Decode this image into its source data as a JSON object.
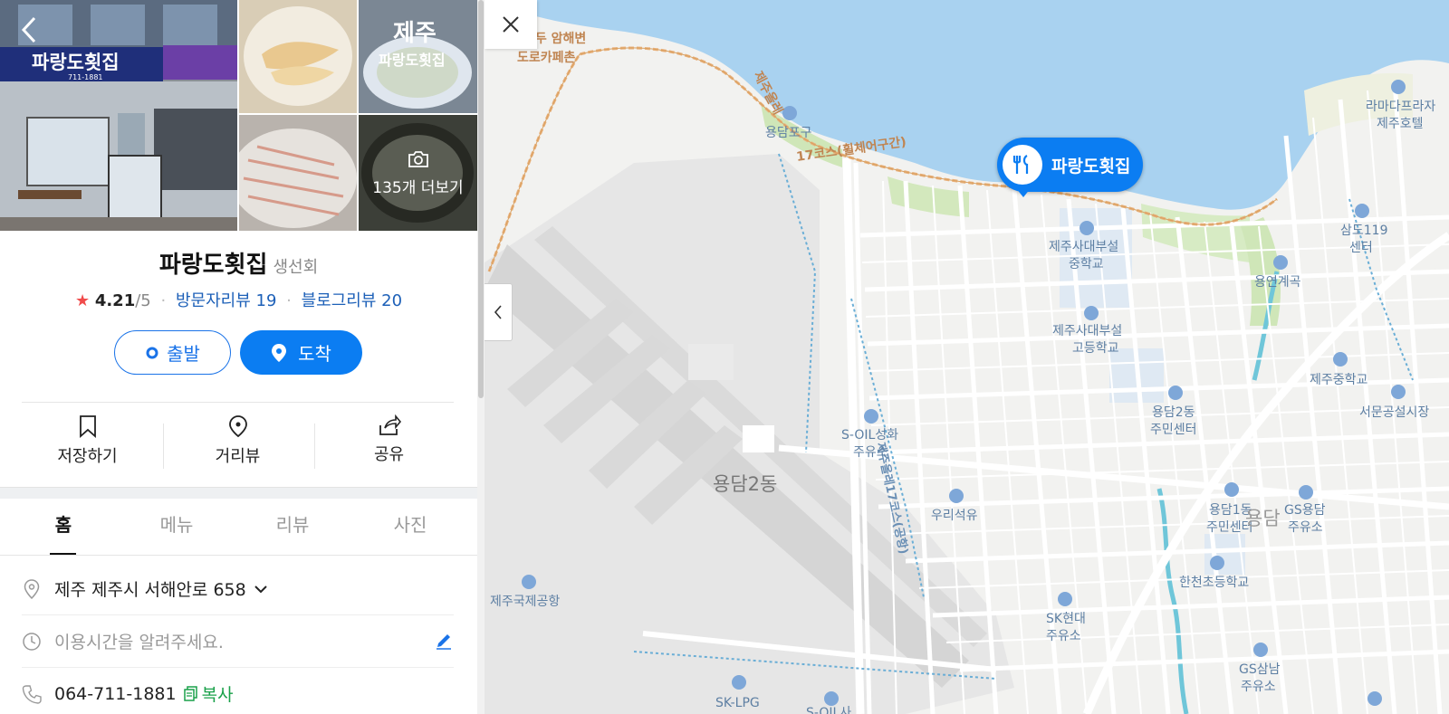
{
  "place": {
    "name": "파랑도횟집",
    "category": "생선회",
    "rating": "4.21",
    "rating_max": "/5",
    "visitor_reviews": "방문자리뷰 19",
    "blog_reviews": "블로그리뷰 20",
    "sign_text": "파랑도횟집",
    "sign_phone": "711-1881",
    "photo_overlay_text": "제주",
    "photo_overlay_sub": "파랑도횟집",
    "photo_more": "135개 더보기"
  },
  "buttons": {
    "start": "출발",
    "arrive": "도착"
  },
  "actions": {
    "save": "저장하기",
    "street_view": "거리뷰",
    "share": "공유"
  },
  "tabs": [
    "홈",
    "메뉴",
    "리뷰",
    "사진"
  ],
  "info": {
    "address": "제주 제주시 서해안로 658",
    "hours_placeholder": "이용시간을 알려주세요.",
    "phone": "064-711-1881",
    "copy": "복사"
  },
  "map": {
    "marker_label": "파랑도횟집",
    "labels": {
      "beach_cafe_1": "도두 암해변",
      "beach_cafe_2": "도로카페촌",
      "yongdam_port": "용담포구",
      "olle_route_17": "17코스(휠체어구간)",
      "olle_route_vertical": "제주올레17코스(공항)",
      "olle_route_top": "제주올레",
      "ramada_1": "라마다프라자",
      "ramada_2": "제주호텔",
      "jeju_middle_1": "제주사대부설",
      "jeju_middle_2": "중학교",
      "jeju_high_1": "제주사대부설",
      "jeju_high_2": "고등학교",
      "samdo_119_1": "삼도119",
      "samdo_119_2": "센터",
      "yongyeon": "용연계곡",
      "jeju_middle_school": "제주중학교",
      "seomun_market": "서문공설시장",
      "yongdam2_center_1": "용담2동",
      "yongdam2_center_2": "주민센터",
      "soil_1": "S-OIL성화",
      "soil_2": "주유소",
      "yongdam2_dong": "용담2동",
      "uri_gas": "우리석유",
      "yongdam1_center_1": "용담1동",
      "yongdam1_center_2": "주민센터",
      "gs_yongdam_1": "GS용담",
      "gs_yongdam_2": "주유소",
      "hancheon_school": "한천초등학교",
      "airport": "제주국제공항",
      "sk_1": "SK현대",
      "sk_2": "주유소",
      "gs_samnam_1": "GS삼남",
      "gs_samnam_2": "주유소",
      "sk_lpg": "SK-LPG",
      "soil_bottom": "S-OIL사",
      "yongdam_big": "용담"
    }
  },
  "colors": {
    "accent": "#0b7df2",
    "link": "#1d60b8",
    "star": "#f04b4b",
    "copy": "#1aa14a",
    "sea": "#a9d2f0",
    "land": "#f2f2f0"
  }
}
